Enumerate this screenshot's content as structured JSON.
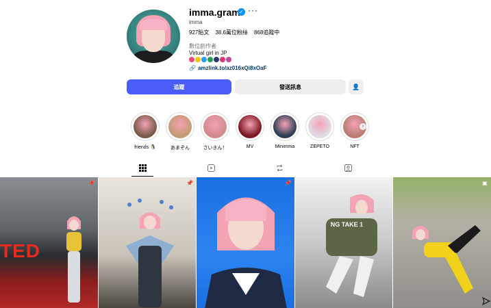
{
  "profile": {
    "username": "imma.gram",
    "full_name": "imma",
    "category": "數位創作者",
    "bio": "Virtual girl in JP",
    "link": "amzlink.to/az016xQi8xOaF",
    "emoji_colors": [
      "#e84a7a",
      "#f5c400",
      "#2a9df4",
      "#1f9d55",
      "#2b3a67",
      "#d4387b",
      "#c04a9b"
    ]
  },
  "stats": {
    "posts": "927貼文",
    "followers": "38.6萬位粉絲",
    "following": "868追蹤中"
  },
  "actions": {
    "follow": "追蹤",
    "message": "發送訊息",
    "suggest_icon": "person-plus-icon"
  },
  "highlights": [
    {
      "label": "friends 🐧",
      "color": "#7a5a4a"
    },
    {
      "label": "あまぞん",
      "color": "#c49a74"
    },
    {
      "label": "さいきん！",
      "color": "#d08a8c"
    },
    {
      "label": "MV",
      "color": "#7a1622"
    },
    {
      "label": "Minimma",
      "color": "#2d3e52"
    },
    {
      "label": "ZEPETO",
      "color": "#e0dbe6"
    },
    {
      "label": "NFT",
      "color": "#b87c72"
    }
  ],
  "tabs": [
    {
      "name": "posts",
      "icon": "grid-icon"
    },
    {
      "name": "reels",
      "icon": "reels-icon"
    },
    {
      "name": "reposts",
      "icon": "repost-icon"
    },
    {
      "name": "tagged",
      "icon": "tagged-icon"
    }
  ],
  "posts": [
    {
      "overlay": "TED",
      "pinned": true
    },
    {
      "overlay": "",
      "pinned": true
    },
    {
      "overlay": "",
      "pinned": true
    },
    {
      "overlay": "NG TAKE 1",
      "pinned": false
    },
    {
      "overlay": "",
      "pinned": false
    }
  ],
  "colors": {
    "accent": "#4a5df9",
    "verified": "#0095f6",
    "link": "#00376b"
  }
}
